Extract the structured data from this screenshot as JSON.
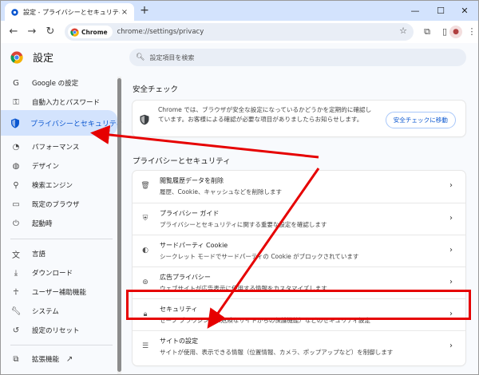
{
  "browser": {
    "tab_title": "設定 - プライバシーとセキュリティ",
    "tab_close": "×",
    "new_tab": "+",
    "omnibox_chip": "Chrome",
    "url": "chrome://settings/privacy"
  },
  "settings": {
    "title": "設定",
    "search_placeholder": "設定項目を検索",
    "sidebar": [
      {
        "label": "Google の設定",
        "icon": "google-icon"
      },
      {
        "label": "自動入力とパスワード",
        "icon": "key-icon"
      },
      {
        "label": "プライバシーとセキュリティ",
        "icon": "shield-icon",
        "active": true
      },
      {
        "label": "パフォーマンス",
        "icon": "speedometer-icon"
      },
      {
        "label": "デザイン",
        "icon": "palette-icon"
      },
      {
        "label": "検索エンジン",
        "icon": "search-icon"
      },
      {
        "label": "既定のブラウザ",
        "icon": "browser-icon"
      },
      {
        "label": "起動時",
        "icon": "power-icon"
      },
      {
        "label": "言語",
        "icon": "translate-icon"
      },
      {
        "label": "ダウンロード",
        "icon": "download-icon"
      },
      {
        "label": "ユーザー補助機能",
        "icon": "accessibility-icon"
      },
      {
        "label": "システム",
        "icon": "wrench-icon"
      },
      {
        "label": "設定のリセット",
        "icon": "reset-icon"
      },
      {
        "label": "拡張機能",
        "icon": "puzzle-icon"
      }
    ],
    "safety_check": {
      "heading": "安全チェック",
      "text": "Chrome では、ブラウザが安全な設定になっているかどうかを定期的に確認しています。お客様による確認が必要な項目がありましたらお知らせします。",
      "button": "安全チェックに移動"
    },
    "privacy": {
      "heading": "プライバシーとセキュリティ",
      "rows": [
        {
          "title": "閲覧履歴データを削除",
          "desc": "履歴、Cookie、キャッシュなどを削除します",
          "icon": "trash-icon"
        },
        {
          "title": "プライバシー ガイド",
          "desc": "プライバシーとセキュリティに関する重要な設定を確認します",
          "icon": "guide-icon"
        },
        {
          "title": "サードパーティ Cookie",
          "desc": "シークレット モードでサードパーティの Cookie がブロックされています",
          "icon": "cookie-icon"
        },
        {
          "title": "広告プライバシー",
          "desc": "ウェブサイトが広告表示に使用する情報をカスタマイズします",
          "icon": "ad-privacy-icon"
        },
        {
          "title": "セキュリティ",
          "desc": "セーフ ブラウジング（危険なサイトからの保護機能）などのセキュリティ設定",
          "icon": "lock-icon"
        },
        {
          "title": "サイトの設定",
          "desc": "サイトが使用、表示できる情報（位置情報、カメラ、ポップアップなど）を制御します",
          "icon": "sliders-icon"
        }
      ]
    }
  },
  "colors": {
    "accent": "#0b57d0",
    "highlight": "#e60000",
    "active_bg": "#d3e3fd"
  }
}
